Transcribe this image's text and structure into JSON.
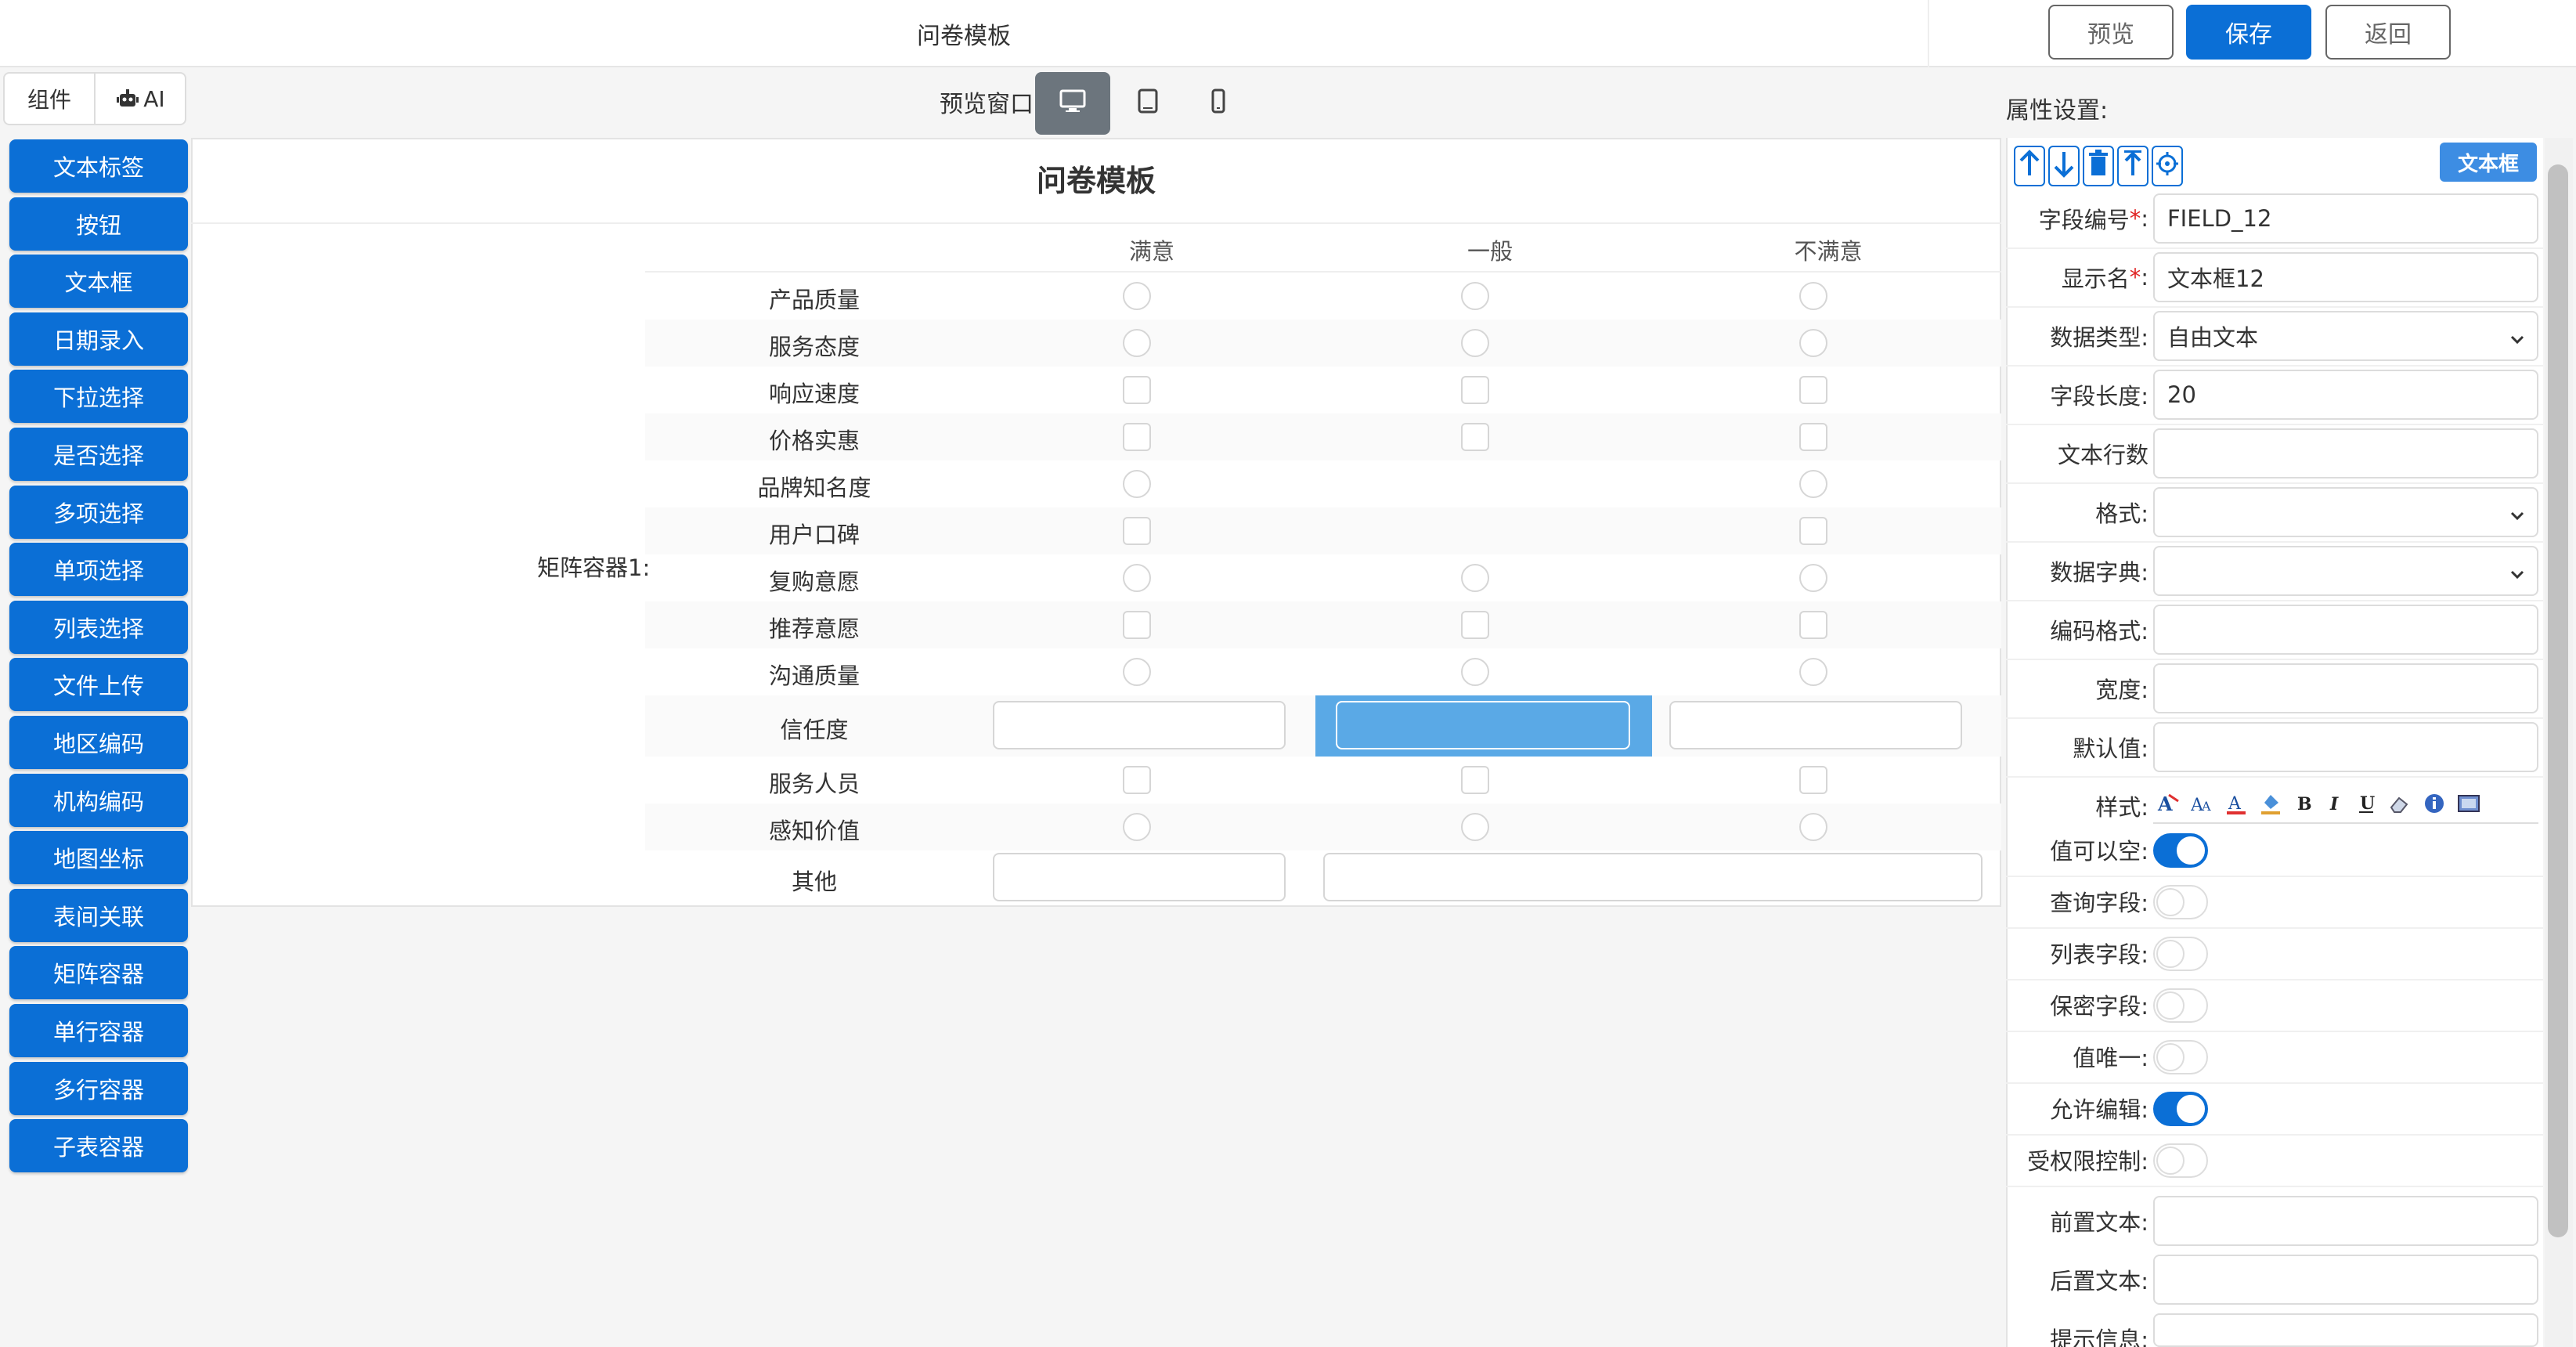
{
  "header": {
    "title": "问卷模板",
    "preview_label": "预览",
    "save_label": "保存",
    "back_label": "返回"
  },
  "tabs": [
    {
      "label": "组件"
    },
    {
      "label": "AI"
    }
  ],
  "preview_window": {
    "label": "预览窗口:",
    "devices": [
      "desktop-icon",
      "tablet-icon",
      "phone-icon"
    ],
    "selected": "desktop"
  },
  "components": [
    "文本标签",
    "按钮",
    "文本框",
    "日期录入",
    "下拉选择",
    "是否选择",
    "多项选择",
    "单项选择",
    "列表选择",
    "文件上传",
    "地区编码",
    "机构编码",
    "地图坐标",
    "表间关联",
    "矩阵容器",
    "单行容器",
    "多行容器",
    "子表容器"
  ],
  "form": {
    "title": "问卷模板",
    "matrix_label": "矩阵容器1:",
    "columns": [
      "满意",
      "一般",
      "不满意"
    ],
    "rows": [
      {
        "label": "产品质量",
        "cells": [
          "radio",
          "radio",
          "radio"
        ]
      },
      {
        "label": "服务态度",
        "cells": [
          "radio",
          "radio",
          "radio"
        ]
      },
      {
        "label": "响应速度",
        "cells": [
          "check",
          "check",
          "check"
        ]
      },
      {
        "label": "价格实惠",
        "cells": [
          "check",
          "check",
          "check"
        ]
      },
      {
        "label": "品牌知名度",
        "cells": [
          "radio",
          "",
          "radio"
        ]
      },
      {
        "label": "用户口碑",
        "cells": [
          "check",
          "",
          "check"
        ]
      },
      {
        "label": "复购意愿",
        "cells": [
          "radio",
          "radio",
          "radio"
        ]
      },
      {
        "label": "推荐意愿",
        "cells": [
          "check",
          "check",
          "check"
        ]
      },
      {
        "label": "沟通质量",
        "cells": [
          "radio",
          "radio",
          "radio"
        ]
      },
      {
        "label": "信任度",
        "cells": [
          "input",
          "input-selected",
          "input"
        ]
      },
      {
        "label": "服务人员",
        "cells": [
          "check",
          "check",
          "check"
        ]
      },
      {
        "label": "感知价值",
        "cells": [
          "radio",
          "radio",
          "radio"
        ]
      },
      {
        "label": "其他",
        "cells": [
          "input",
          "input-wide",
          ""
        ]
      }
    ]
  },
  "properties": {
    "panel_label": "属性设置:",
    "type_badge": "文本框",
    "toolbar": [
      "arrow-up-icon",
      "arrow-down-icon",
      "trash-icon",
      "move-top-icon",
      "target-icon"
    ],
    "fields": [
      {
        "label": "字段编号",
        "required": true,
        "value": "FIELD_12",
        "kind": "text"
      },
      {
        "label": "显示名",
        "required": true,
        "value": "文本框12",
        "kind": "text"
      },
      {
        "label": "数据类型:",
        "value": "自由文本",
        "kind": "select"
      },
      {
        "label": "字段长度:",
        "value": "20",
        "kind": "text"
      },
      {
        "label": "文本行数",
        "value": "",
        "kind": "text"
      },
      {
        "label": "格式:",
        "value": "",
        "kind": "select"
      },
      {
        "label": "数据字典:",
        "value": "",
        "kind": "select"
      },
      {
        "label": "编码格式:",
        "value": "",
        "kind": "text"
      },
      {
        "label": "宽度:",
        "value": "",
        "kind": "text"
      },
      {
        "label": "默认值:",
        "value": "",
        "kind": "text"
      }
    ],
    "style_label": "样式:",
    "toggles": [
      {
        "label": "值可以空:",
        "on": true
      },
      {
        "label": "查询字段:",
        "on": false
      },
      {
        "label": "列表字段:",
        "on": false
      },
      {
        "label": "保密字段:",
        "on": false
      },
      {
        "label": "值唯一:",
        "on": false
      },
      {
        "label": "允许编辑:",
        "on": true
      },
      {
        "label": "受权限控制:",
        "on": false
      }
    ],
    "bottom_fields": [
      {
        "label": "前置文本:",
        "value": ""
      },
      {
        "label": "后置文本:",
        "value": ""
      },
      {
        "label": "提示信息:",
        "value": ""
      }
    ]
  },
  "colors": {
    "primary": "#0b6fd6",
    "selected_cell": "#5aa9e6"
  }
}
